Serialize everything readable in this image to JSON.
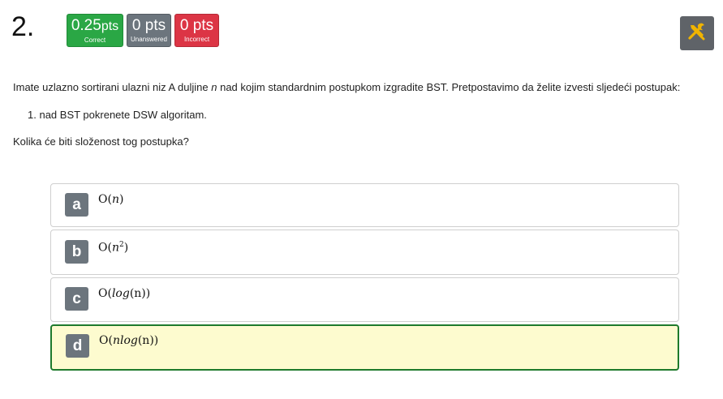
{
  "question": {
    "number": "2.",
    "badges": {
      "correct": {
        "value": "0.25",
        "unit": "pts",
        "label": "Correct"
      },
      "unanswered": {
        "value": "0",
        "unit": "pts",
        "label": "Unanswered"
      },
      "incorrect": {
        "value": "0",
        "unit": "pts",
        "label": "Incorrect"
      }
    },
    "text": {
      "intro_a": "Imate uzlazno sortirani ulazni niz A duljine ",
      "intro_var": "n",
      "intro_b": " nad kojim standardnim postupkom izgradite BST. Pretpostavimo da želite izvesti sljedeći postupak:",
      "step_number": "1.",
      "step_text": "nad BST pokrenete DSW algoritam.",
      "ask": "Kolika će biti složenost tog postupka?"
    },
    "tools_icon": "tools-icon"
  },
  "answers": [
    {
      "letter": "a",
      "prefix": "O(",
      "var": "n",
      "suffix": ")"
    },
    {
      "letter": "b",
      "prefix": "O(",
      "var": "n",
      "sup": "2",
      "suffix": ")"
    },
    {
      "letter": "c",
      "prefix": "O(",
      "var": "log",
      "paren": "(n)",
      "suffix": ")"
    },
    {
      "letter": "d",
      "prefix": "O(",
      "var": "nlog",
      "paren": "(n)",
      "suffix": ")",
      "selected": true
    }
  ],
  "colors": {
    "correct": "#2aa745",
    "unanswered": "#6c757d",
    "incorrect": "#dc3545",
    "selected_bg": "#fdfbcf",
    "selected_border": "#1e7a2c"
  }
}
